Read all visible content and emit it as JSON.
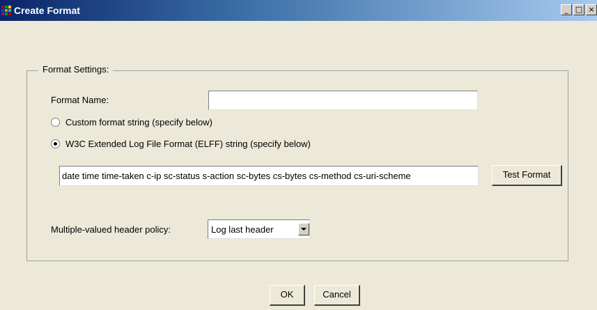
{
  "window": {
    "title": "Create Format",
    "minimize_glyph": "_",
    "maximize_glyph": "□",
    "close_glyph": "×"
  },
  "group": {
    "legend": "Format Settings:"
  },
  "format_name": {
    "label": "Format Name:",
    "value": ""
  },
  "radios": {
    "custom_label": "Custom format string (specify below)",
    "w3c_label": "W3C Extended Log File Format (ELFF) string (specify below)",
    "selected": "w3c"
  },
  "format_string": {
    "value": "date time time-taken c-ip sc-status s-action sc-bytes cs-bytes cs-method cs-uri-scheme"
  },
  "buttons": {
    "test_format": "Test Format",
    "ok": "OK",
    "cancel": "Cancel"
  },
  "header_policy": {
    "label": "Multiple-valued header policy:",
    "value": "Log last header"
  }
}
